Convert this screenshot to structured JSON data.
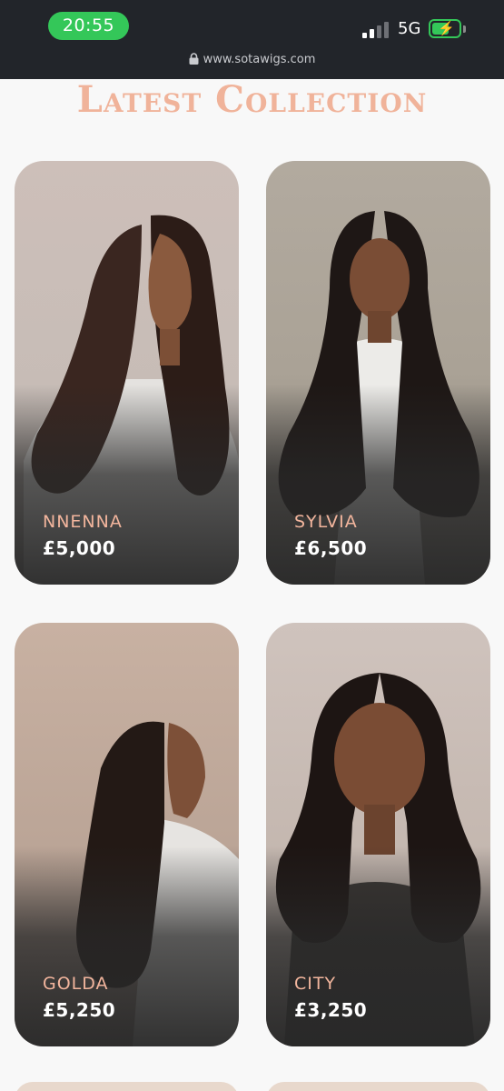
{
  "status": {
    "time": "20:55",
    "network": "5G",
    "battery_level": 0.55
  },
  "browser": {
    "url": "www.sotawigs.com"
  },
  "section": {
    "title": "Latest Collection"
  },
  "products": [
    {
      "name": "NNENNA",
      "price": "£5,000"
    },
    {
      "name": "SYLVIA",
      "price": "£6,500"
    },
    {
      "name": "GOLDA",
      "price": "£5,250"
    },
    {
      "name": "CITY",
      "price": "£3,250"
    }
  ],
  "colors": {
    "accent": "#f0b39a",
    "status_green": "#34c759",
    "card_dark": "#2a2a2a"
  }
}
